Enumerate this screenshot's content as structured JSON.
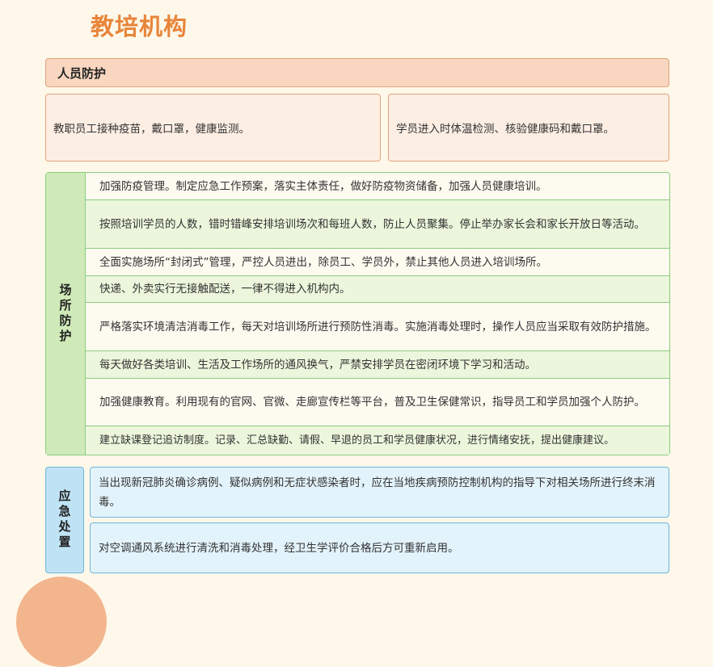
{
  "title": "教培机构",
  "personal": {
    "header": "人员防护",
    "items": [
      "教职员工接种疫苗，戴口罩，健康监测。",
      "学员进入时体温检测、核验健康码和戴口罩。"
    ]
  },
  "venue": {
    "label": "场所防护",
    "items": [
      "加强防疫管理。制定应急工作预案，落实主体责任，做好防疫物资储备，加强人员健康培训。",
      "按照培训学员的人数，错时错峰安排培训场次和每班人数，防止人员聚集。停止举办家长会和家长开放日等活动。",
      "全面实施场所“封闭式”管理，严控人员进出，除员工、学员外，禁止其他人员进入培训场所。",
      "快递、外卖实行无接触配送，一律不得进入机构内。",
      "严格落实环境清洁消毒工作，每天对培训场所进行预防性消毒。实施消毒处理时，操作人员应当采取有效防护措施。",
      "每天做好各类培训、生活及工作场所的通风换气，严禁安排学员在密闭环境下学习和活动。",
      "加强健康教育。利用现有的官网、官微、走廊宣传栏等平台，普及卫生保健常识，指导员工和学员加强个人防护。",
      "建立缺课登记追访制度。记录、汇总缺勤、请假、早退的员工和学员健康状况，进行情绪安抚，提出健康建议。"
    ]
  },
  "emergency": {
    "label": "应急处置",
    "items": [
      "当出现新冠肺炎确诊病例、疑似病例和无症状感染者时，应在当地疾病预防控制机构的指导下对相关场所进行终末消毒。",
      "对空调通风系统进行清洗和消毒处理，经卫生学评价合格后方可重新启用。"
    ]
  },
  "colors": {
    "title": "#e8853a",
    "personal_header_bg": "#f8d6c0",
    "personal_card_bg": "#fdeee4",
    "venue_label_bg": "#cfeab8",
    "emergency_label_bg": "#bfe3f5",
    "emergency_card_bg": "#e3f3fb"
  }
}
